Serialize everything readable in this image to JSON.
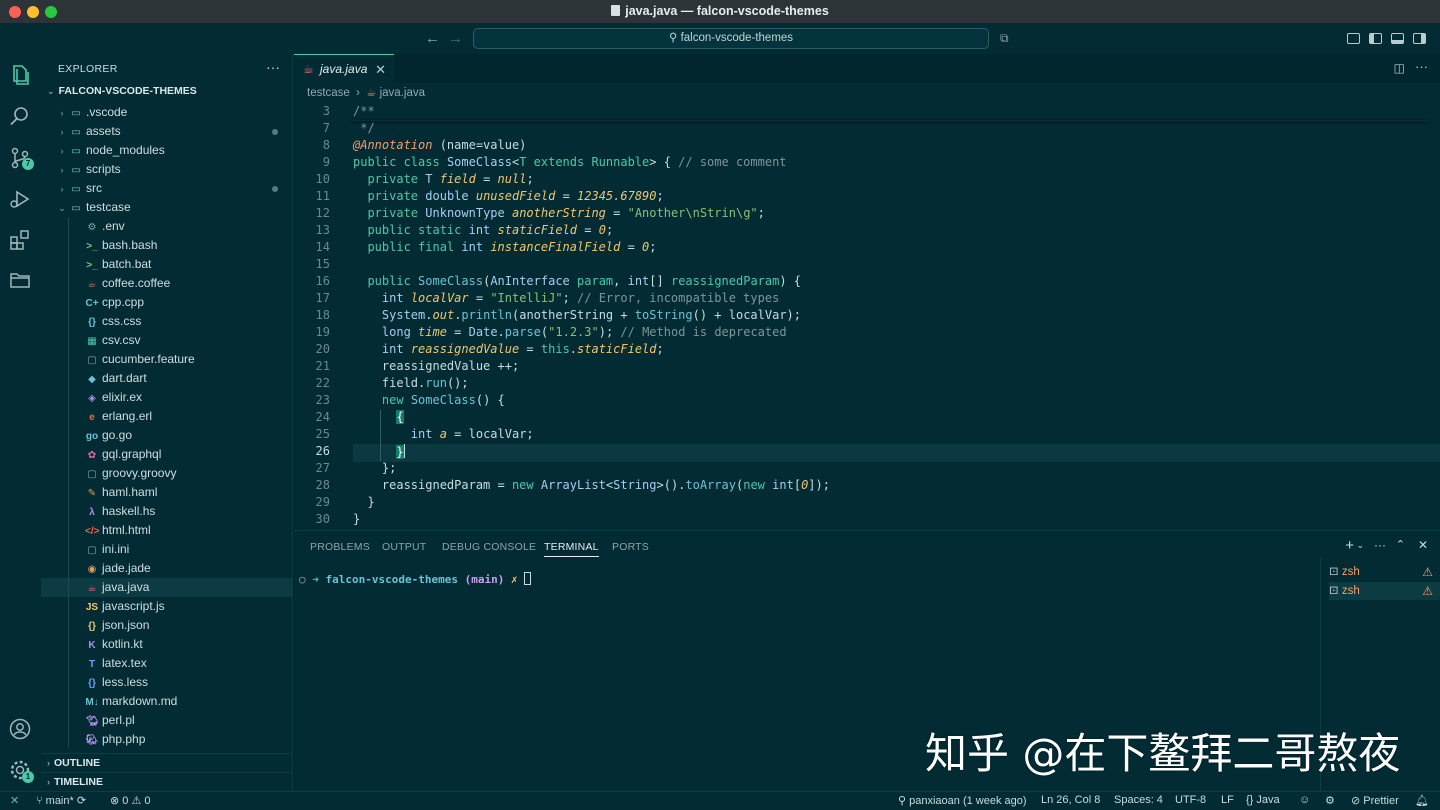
{
  "window": {
    "title": "java.java — falcon-vscode-themes"
  },
  "command_center": {
    "search": "falcon-vscode-themes"
  },
  "activity": {
    "scm_badge": "7",
    "settings_badge": "1"
  },
  "explorer": {
    "header": "EXPLORER",
    "root": "FALCON-VSCODE-THEMES",
    "folders": [
      ".vscode",
      "assets",
      "node_modules",
      "scripts",
      "src",
      "testcase"
    ],
    "files": [
      ".env",
      "bash.bash",
      "batch.bat",
      "coffee.coffee",
      "cpp.cpp",
      "css.css",
      "csv.csv",
      "cucumber.feature",
      "dart.dart",
      "elixir.ex",
      "erlang.erl",
      "go.go",
      "gql.graphql",
      "groovy.groovy",
      "haml.haml",
      "haskell.hs",
      "html.html",
      "ini.ini",
      "jade.jade",
      "java.java",
      "javascript.js",
      "json.json",
      "kotlin.kt",
      "latex.tex",
      "less.less",
      "markdown.md",
      "perl.pl",
      "php.php"
    ],
    "outline": "OUTLINE",
    "timeline": "TIMELINE"
  },
  "editor": {
    "tab": "java.java",
    "crumbs": [
      "testcase",
      "java.java"
    ],
    "line_numbers": [
      "3",
      "7",
      "8",
      "9",
      "10",
      "11",
      "12",
      "13",
      "14",
      "15",
      "16",
      "17",
      "18",
      "19",
      "20",
      "21",
      "22",
      "23",
      "24",
      "25",
      "26",
      "27",
      "28",
      "29",
      "30"
    ]
  },
  "panel": {
    "tabs": [
      "PROBLEMS",
      "OUTPUT",
      "DEBUG CONSOLE",
      "TERMINAL",
      "PORTS"
    ],
    "prompt_dir": "falcon-vscode-themes",
    "prompt_branch": "(main)",
    "terminals": [
      "zsh",
      "zsh"
    ]
  },
  "status": {
    "branch": "main*",
    "problems": "0",
    "warnings": "0",
    "blame": "panxiaoan (1 week ago)",
    "position": "Ln 26, Col 8",
    "spaces": "Spaces: 4",
    "encoding": "UTF-8",
    "eol": "LF",
    "language": "Java",
    "prettier": "Prettier"
  },
  "watermark": "知乎 @在下鳌拜二哥熬夜",
  "colors": {
    "bg": "#022b33",
    "accent": "#4ec9a8",
    "keyword": "#4ec9a8",
    "string": "#88c078",
    "warning": "#f3a26a"
  }
}
